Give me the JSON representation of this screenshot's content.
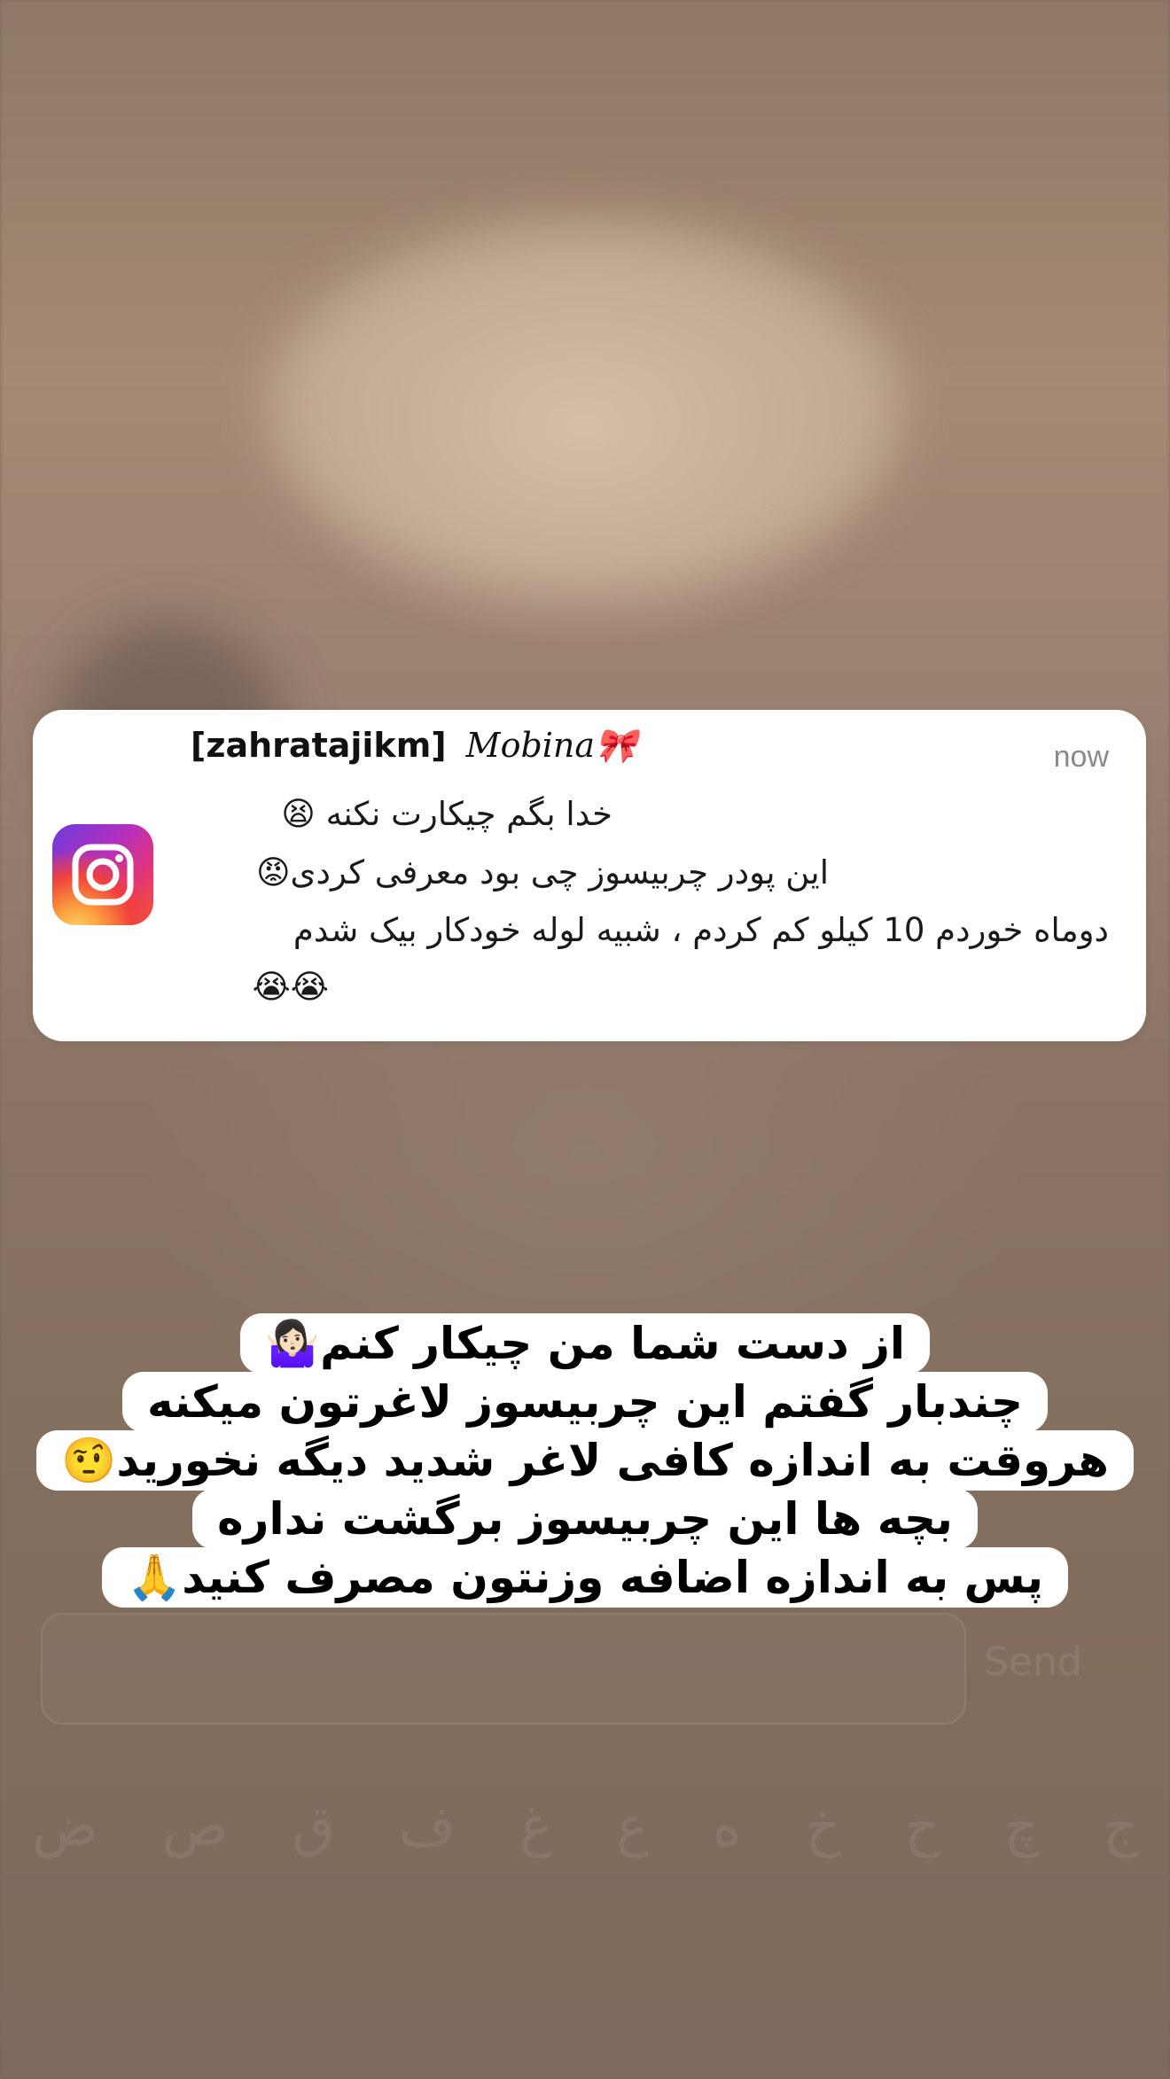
{
  "notification": {
    "app_icon": "instagram-icon",
    "sender_handle": "[zahratajikm]",
    "sender_nickname": "Mobina🎀",
    "time": "now",
    "lines": [
      "خدا بگم چیکارت نکنه 😫",
      "این پودر چربیسوز چی بود معرفی کردی😡",
      "دوماه خوردم 10 کیلو کم کردم ، شبیه لوله خودکار بیک شدم",
      "😭😭"
    ]
  },
  "caption": {
    "lines": [
      "از دست شما من چیکار کنم🤷🏻‍♀️",
      "چندبار گفتم این چربیسوز لاغرتون میکنه",
      "هروقت به اندازه کافی لاغر شدید دیگه نخورید🤨",
      "بچه ها این چربیسوز برگشت نداره",
      "پس به اندازه اضافه وزنتون مصرف کنید🙏"
    ]
  },
  "background": {
    "send_label": "Send",
    "keys": [
      "ج",
      "چ",
      "ح",
      "خ",
      "ه",
      "ع",
      "غ",
      "ف",
      "ق",
      "ص",
      "ض"
    ]
  },
  "colors": {
    "card_background": "#ffffff",
    "time_gray": "#8a8a8e",
    "background_brown": "#7d675a"
  }
}
